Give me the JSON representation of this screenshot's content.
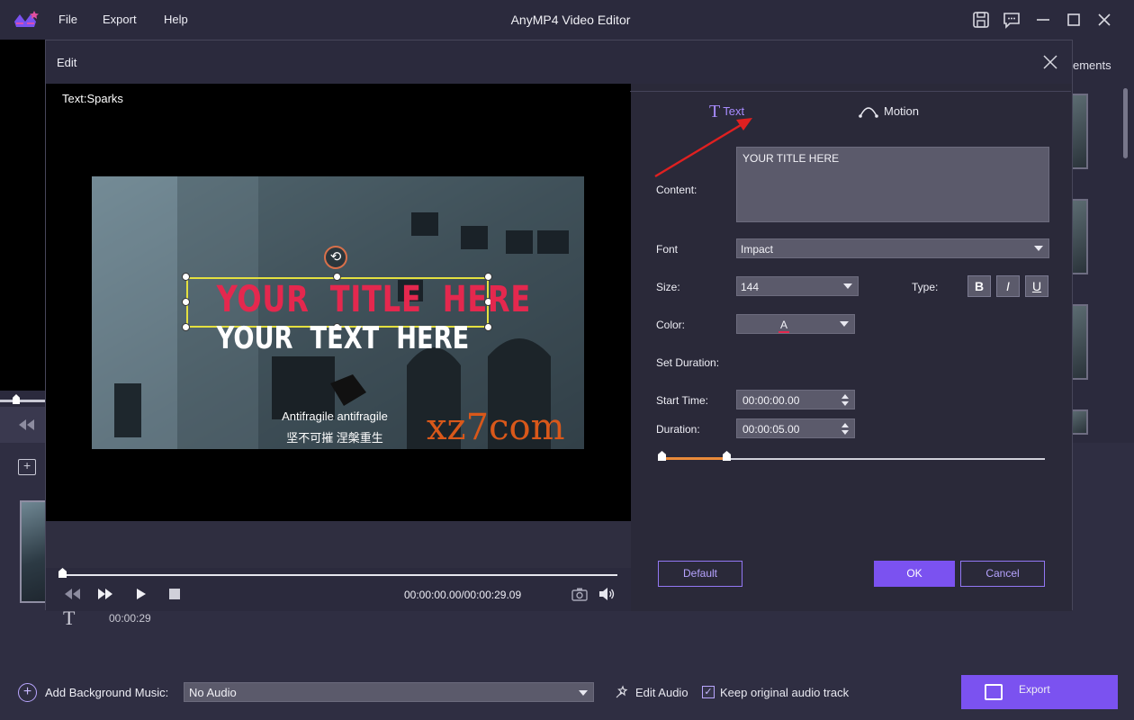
{
  "app": {
    "title": "AnyMP4 Video Editor",
    "menu": [
      "File",
      "Export",
      "Help"
    ]
  },
  "background": {
    "right_panel_text": "ements",
    "timeline_time": "00:00:29",
    "bottom": {
      "add_music_label": "Add Background Music:",
      "audio_value": "No Audio",
      "edit_audio_label": "Edit Audio",
      "keep_original_label": "Keep original audio track",
      "keep_original_checked": true,
      "export_label": "Export"
    }
  },
  "dialog": {
    "title": "Edit",
    "preview": {
      "label": "Text:Sparks",
      "overlay_title": "YOUR  TITLE  HERE",
      "overlay_subtitle": "YOUR  TEXT  HERE",
      "caption_line1": "Antifragile antifragile",
      "caption_line2": "坚不可摧 涅槃重生",
      "watermark": "xz7com",
      "timecode": "00:00:00.00/00:00:29.09",
      "playhead_progress": 0
    },
    "tabs": {
      "text": "Text",
      "motion": "Motion",
      "active": "text"
    },
    "form": {
      "content_label": "Content:",
      "content_value": "YOUR TITLE HERE",
      "font_label": "Font",
      "font_value": "Impact",
      "size_label": "Size:",
      "size_value": "144",
      "type_label": "Type:",
      "type_buttons": [
        "B",
        "I",
        "U"
      ],
      "color_label": "Color:",
      "color_value": "A",
      "set_duration_label": "Set Duration:",
      "start_time_label": "Start Time:",
      "start_time_value": "00:00:00.00",
      "duration_label": "Duration:",
      "duration_value": "00:00:05.00"
    },
    "buttons": {
      "default": "Default",
      "ok": "OK",
      "cancel": "Cancel"
    }
  },
  "colors": {
    "accent": "#7b52f0",
    "accent_text": "#a88cff",
    "title_text": "#e4284e",
    "annotation_arrow": "#e02020"
  }
}
